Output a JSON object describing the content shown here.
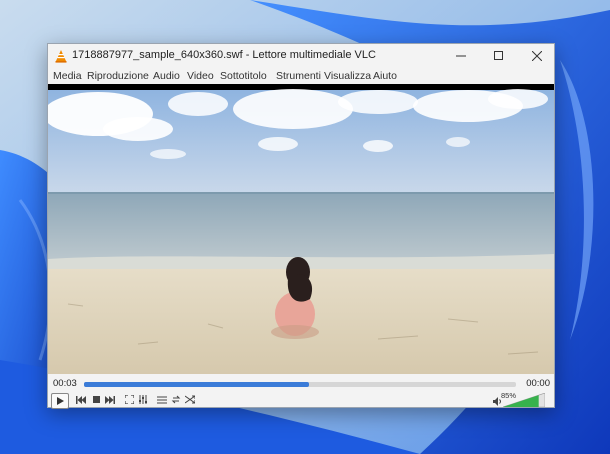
{
  "window": {
    "title": "1718887977_sample_640x360.swf - Lettore multimediale VLC",
    "minimize_icon": "minimize-icon",
    "maximize_icon": "maximize-icon",
    "close_icon": "close-icon"
  },
  "menu": {
    "items": [
      "Media",
      "Riproduzione",
      "Audio",
      "Video",
      "Sottotitolo",
      "Strumenti",
      "Visualizza",
      "Aiuto"
    ]
  },
  "player": {
    "elapsed": "00:03",
    "remaining": "00:00",
    "progress_fraction": 0.52,
    "volume_label": "85%",
    "volume_fraction": 0.85
  },
  "colors": {
    "accent": "#3b7cd8",
    "volume": "#37b24d"
  }
}
